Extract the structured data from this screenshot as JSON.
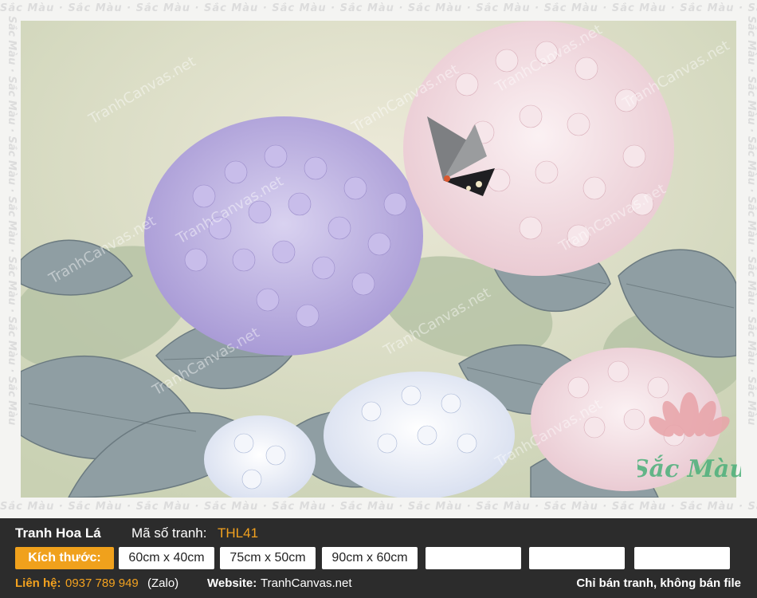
{
  "watermark": {
    "site": "TranhCanvas.net",
    "brand": "Sắc Màu"
  },
  "painting": {
    "subject": "hydrangea-and-butterfly",
    "colors": {
      "background": "#dfe3cf",
      "purple_flowers": "#b9aee0",
      "pink_flowers": "#f1dde2",
      "white_flowers": "#eef0f6",
      "leaves": "#8f9ea0",
      "leaves_dark": "#6f7f86"
    }
  },
  "logo": {
    "text": "Sắc Màu",
    "lotus_color": "#e8a3a8",
    "text_color": "#4bb07a"
  },
  "info": {
    "title": "Tranh Hoa Lá",
    "code_label": "Mã số tranh:",
    "code_value": "THL41",
    "size_label": "Kích thước:",
    "sizes": [
      "60cm x 40cm",
      "75cm x 50cm",
      "90cm x 60cm",
      "",
      "",
      ""
    ],
    "contact_label": "Liên hệ:",
    "contact_phone": "0937 789 949",
    "contact_app": "(Zalo)",
    "website_label": "Website:",
    "website_value": "TranhCanvas.net",
    "note": "Chỉ bán tranh, không bán file"
  },
  "colors": {
    "accent": "#f0a11c",
    "bar": "#2c2c2c"
  }
}
